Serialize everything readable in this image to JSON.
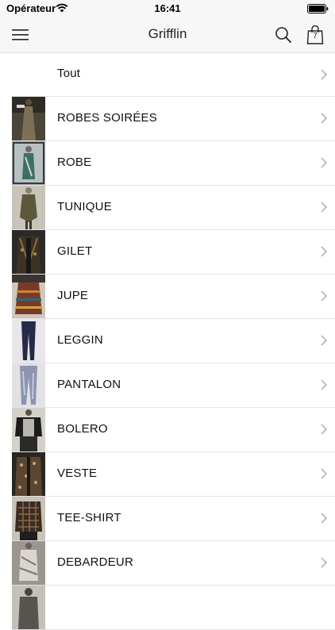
{
  "status_bar": {
    "carrier": "Opérateur",
    "time": "16:41"
  },
  "nav": {
    "title": "Grifflin",
    "cart_count": "7"
  },
  "categories": [
    {
      "label": "Tout",
      "thumb": "none"
    },
    {
      "label": "ROBES SOIRÉES",
      "thumb": "long-dress"
    },
    {
      "label": "ROBE",
      "thumb": "dress"
    },
    {
      "label": "TUNIQUE",
      "thumb": "tunic"
    },
    {
      "label": "GILET",
      "thumb": "cardigan"
    },
    {
      "label": "JUPE",
      "thumb": "skirt"
    },
    {
      "label": "LEGGIN",
      "thumb": "leggings"
    },
    {
      "label": "PANTALON",
      "thumb": "trousers"
    },
    {
      "label": "BOLERO",
      "thumb": "bolero"
    },
    {
      "label": "VESTE",
      "thumb": "jacket"
    },
    {
      "label": "TEE-SHIRT",
      "thumb": "tee-shirt"
    },
    {
      "label": "DEBARDEUR",
      "thumb": "tank-top"
    },
    {
      "label": "",
      "thumb": "partial"
    }
  ],
  "colors": {
    "bar_bg": "#f7f7f7",
    "separator": "#e3e3e3",
    "chevron": "#b5b5b5"
  }
}
